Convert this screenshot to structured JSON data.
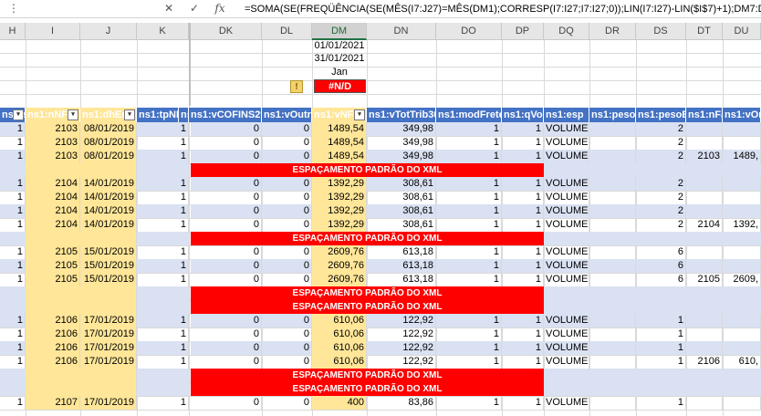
{
  "formula_bar": {
    "cancel_icon": "close-icon",
    "confirm_icon": "check-icon",
    "fx_label": "fx",
    "formula": "=SOMA(SE(FREQÜÊNCIA(SE(MÊS(I7:J27)=MÊS(DM1);CORRESP(I7:I27;I7:I27;0));LIN(I7:I27)-LIN($I$7)+1);DM7:DM27))"
  },
  "columns": [
    "H",
    "I",
    "J",
    "K",
    "DK",
    "DL",
    "DM",
    "DN",
    "DO",
    "DP",
    "DQ",
    "DR",
    "DS",
    "DT",
    "DU"
  ],
  "top_cells": {
    "date_start": "01/01/2021",
    "date_end": "31/01/2021",
    "month": "Jan",
    "error": "#N/D",
    "warn": "!"
  },
  "headers": [
    "ns1:ser",
    "ns1:nNF",
    "ns1:dhEmi",
    "ns1:tpNF",
    "ns",
    "ns1:vCOFINS29",
    "ns1:vOutro",
    "ns1:vNF",
    "ns1:vTotTrib30",
    "ns1:modFrete",
    "ns1:qVol",
    "ns1:esp",
    "ns1:pesoL",
    "ns1:pesoB",
    "ns1:nFat",
    "ns1:vOri"
  ],
  "spacer_text": "ESPAÇAMENTO PADRÃO DO XML",
  "rows": [
    {
      "type": "data",
      "blue": true,
      "h": "1",
      "i": "2103",
      "j": "08/01/2019",
      "k": "1",
      "dk": "0",
      "dl": "0",
      "dm": "1489,54",
      "dn": "349,98",
      "do": "1",
      "dp": "1",
      "dq": "VOLUME",
      "ds": "2",
      "dt": "",
      "du": ""
    },
    {
      "type": "data",
      "blue": false,
      "h": "1",
      "i": "2103",
      "j": "08/01/2019",
      "k": "1",
      "dk": "0",
      "dl": "0",
      "dm": "1489,54",
      "dn": "349,98",
      "do": "1",
      "dp": "1",
      "dq": "VOLUME",
      "ds": "2",
      "dt": "",
      "du": ""
    },
    {
      "type": "data",
      "blue": true,
      "h": "1",
      "i": "2103",
      "j": "08/01/2019",
      "k": "1",
      "dk": "0",
      "dl": "0",
      "dm": "1489,54",
      "dn": "349,98",
      "do": "1",
      "dp": "1",
      "dq": "VOLUME",
      "ds": "2",
      "dt": "2103",
      "du": "1489,"
    },
    {
      "type": "spacer"
    },
    {
      "type": "data",
      "blue": true,
      "h": "1",
      "i": "2104",
      "j": "14/01/2019",
      "k": "1",
      "dk": "0",
      "dl": "0",
      "dm": "1392,29",
      "dn": "308,61",
      "do": "1",
      "dp": "1",
      "dq": "VOLUME",
      "ds": "2",
      "dt": "",
      "du": ""
    },
    {
      "type": "data",
      "blue": false,
      "h": "1",
      "i": "2104",
      "j": "14/01/2019",
      "k": "1",
      "dk": "0",
      "dl": "0",
      "dm": "1392,29",
      "dn": "308,61",
      "do": "1",
      "dp": "1",
      "dq": "VOLUME",
      "ds": "2",
      "dt": "",
      "du": ""
    },
    {
      "type": "data",
      "blue": true,
      "h": "1",
      "i": "2104",
      "j": "14/01/2019",
      "k": "1",
      "dk": "0",
      "dl": "0",
      "dm": "1392,29",
      "dn": "308,61",
      "do": "1",
      "dp": "1",
      "dq": "VOLUME",
      "ds": "2",
      "dt": "",
      "du": ""
    },
    {
      "type": "data",
      "blue": false,
      "h": "1",
      "i": "2104",
      "j": "14/01/2019",
      "k": "1",
      "dk": "0",
      "dl": "0",
      "dm": "1392,29",
      "dn": "308,61",
      "do": "1",
      "dp": "1",
      "dq": "VOLUME",
      "ds": "2",
      "dt": "2104",
      "du": "1392,"
    },
    {
      "type": "spacer"
    },
    {
      "type": "data",
      "blue": false,
      "h": "1",
      "i": "2105",
      "j": "15/01/2019",
      "k": "1",
      "dk": "0",
      "dl": "0",
      "dm": "2609,76",
      "dn": "613,18",
      "do": "1",
      "dp": "1",
      "dq": "VOLUME",
      "ds": "6",
      "dt": "",
      "du": ""
    },
    {
      "type": "data",
      "blue": true,
      "h": "1",
      "i": "2105",
      "j": "15/01/2019",
      "k": "1",
      "dk": "0",
      "dl": "0",
      "dm": "2609,76",
      "dn": "613,18",
      "do": "1",
      "dp": "1",
      "dq": "VOLUME",
      "ds": "6",
      "dt": "",
      "du": ""
    },
    {
      "type": "data",
      "blue": false,
      "h": "1",
      "i": "2105",
      "j": "15/01/2019",
      "k": "1",
      "dk": "0",
      "dl": "0",
      "dm": "2609,76",
      "dn": "613,18",
      "do": "1",
      "dp": "1",
      "dq": "VOLUME",
      "ds": "6",
      "dt": "2105",
      "du": "2609,"
    },
    {
      "type": "spacer"
    },
    {
      "type": "spacer"
    },
    {
      "type": "data",
      "blue": true,
      "h": "1",
      "i": "2106",
      "j": "17/01/2019",
      "k": "1",
      "dk": "0",
      "dl": "0",
      "dm": "610,06",
      "dn": "122,92",
      "do": "1",
      "dp": "1",
      "dq": "VOLUME",
      "ds": "1",
      "dt": "",
      "du": ""
    },
    {
      "type": "data",
      "blue": false,
      "h": "1",
      "i": "2106",
      "j": "17/01/2019",
      "k": "1",
      "dk": "0",
      "dl": "0",
      "dm": "610,06",
      "dn": "122,92",
      "do": "1",
      "dp": "1",
      "dq": "VOLUME",
      "ds": "1",
      "dt": "",
      "du": ""
    },
    {
      "type": "data",
      "blue": true,
      "h": "1",
      "i": "2106",
      "j": "17/01/2019",
      "k": "1",
      "dk": "0",
      "dl": "0",
      "dm": "610,06",
      "dn": "122,92",
      "do": "1",
      "dp": "1",
      "dq": "VOLUME",
      "ds": "1",
      "dt": "",
      "du": ""
    },
    {
      "type": "data",
      "blue": false,
      "h": "1",
      "i": "2106",
      "j": "17/01/2019",
      "k": "1",
      "dk": "0",
      "dl": "0",
      "dm": "610,06",
      "dn": "122,92",
      "do": "1",
      "dp": "1",
      "dq": "VOLUME",
      "ds": "1",
      "dt": "2106",
      "du": "610,"
    },
    {
      "type": "spacer"
    },
    {
      "type": "spacer"
    },
    {
      "type": "data",
      "blue": false,
      "h": "1",
      "i": "2107",
      "j": "17/01/2019",
      "k": "1",
      "dk": "0",
      "dl": "0",
      "dm": "400",
      "dn": "83,86",
      "do": "1",
      "dp": "1",
      "dq": "VOLUME",
      "ds": "1",
      "dt": "",
      "du": ""
    }
  ]
}
